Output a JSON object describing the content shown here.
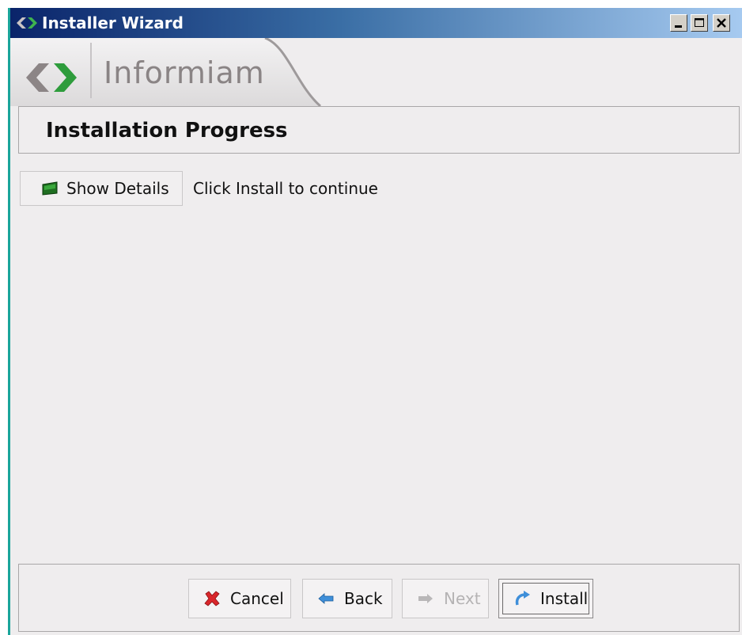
{
  "window": {
    "title": "Installer Wizard",
    "colors": {
      "titlebar_start": "#0a246a",
      "titlebar_end": "#a6caf0",
      "brand_gray": "#8a8485",
      "brand_green": "#2e9c3c"
    }
  },
  "banner": {
    "logo_text": "Informiam"
  },
  "section": {
    "heading": "Installation Progress"
  },
  "details": {
    "show_details_label": "Show Details",
    "show_details_icon": "green-screen-icon",
    "status_text": "Click Install to continue"
  },
  "footer": {
    "cancel_label": "Cancel",
    "cancel_icon": "red-x-icon",
    "back_label": "Back",
    "back_icon": "arrow-left-icon",
    "next_label": "Next",
    "next_icon": "arrow-right-icon",
    "next_enabled": false,
    "install_label": "Install",
    "install_icon": "curved-arrow-icon"
  }
}
